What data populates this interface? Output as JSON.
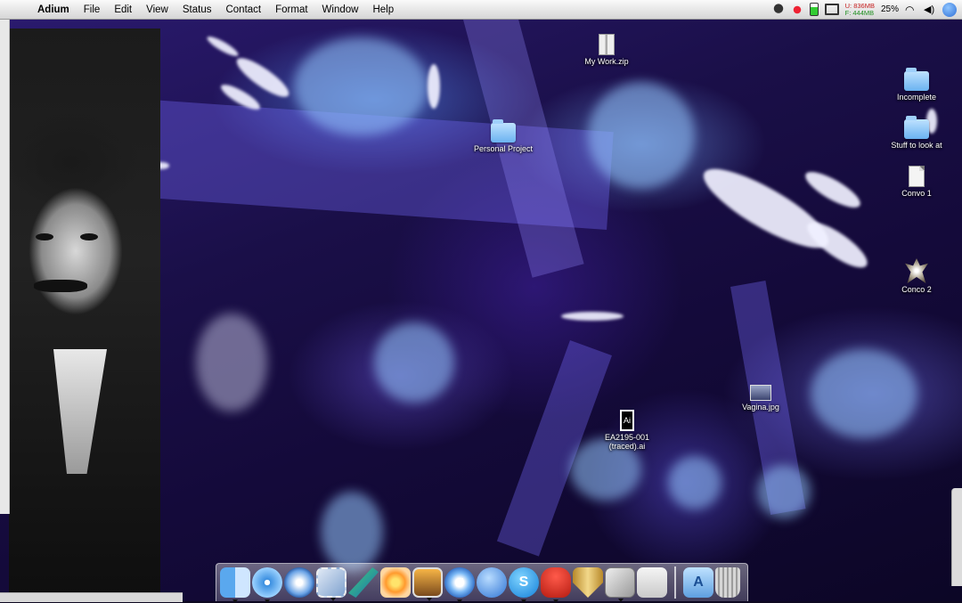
{
  "menubar": {
    "apple_icon": "apple-icon",
    "app_name": "Adium",
    "menus": [
      "File",
      "Edit",
      "View",
      "Status",
      "Contact",
      "Format",
      "Window",
      "Help"
    ],
    "status_items": {
      "memory_used_label": "U:",
      "memory_used": "836MB",
      "memory_free_label": "F:",
      "memory_free": "444MB",
      "battery_percent": "25%"
    }
  },
  "desktop": {
    "icons": [
      {
        "name": "My Work.zip",
        "kind": "zip"
      },
      {
        "name": "Personal Project",
        "kind": "folder"
      },
      {
        "name": "Incomplete",
        "kind": "folder"
      },
      {
        "name": "Stuff to look at",
        "kind": "folder"
      },
      {
        "name": "Convo 1",
        "kind": "document"
      },
      {
        "name": "Conco 2",
        "kind": "image"
      },
      {
        "name": "Vagina.jpg",
        "kind": "jpg"
      },
      {
        "name": "EA2195-001\n(traced).ai",
        "kind": "illustrator"
      }
    ]
  },
  "dock": {
    "apps": [
      {
        "name": "Finder",
        "icon": "finder-icon",
        "running": true
      },
      {
        "name": "Safari",
        "icon": "safari-icon",
        "running": true
      },
      {
        "name": "Dashboard",
        "icon": "compass-icon",
        "running": false
      },
      {
        "name": "Mail",
        "icon": "mail-stamp-icon",
        "running": true
      },
      {
        "name": "Feather",
        "icon": "feather-icon",
        "running": true
      },
      {
        "name": "Flower",
        "icon": "flower-icon",
        "running": false
      },
      {
        "name": "iPhoto",
        "icon": "photo-icon",
        "running": true
      },
      {
        "name": "iTunes",
        "icon": "itunes-icon",
        "running": true
      },
      {
        "name": "iChat",
        "icon": "ichat-icon",
        "running": false
      },
      {
        "name": "Skype",
        "icon": "skype-icon",
        "running": true
      },
      {
        "name": "Adium",
        "icon": "duck-icon",
        "running": true
      },
      {
        "name": "Security",
        "icon": "shield-icon",
        "running": false
      },
      {
        "name": "Utility",
        "icon": "tools-icon",
        "running": true
      },
      {
        "name": "Apple",
        "icon": "apple-box-icon",
        "running": false
      },
      {
        "name": "Applications",
        "icon": "applications-folder-icon",
        "running": false
      },
      {
        "name": "Trash",
        "icon": "trash-icon",
        "running": false
      }
    ]
  }
}
